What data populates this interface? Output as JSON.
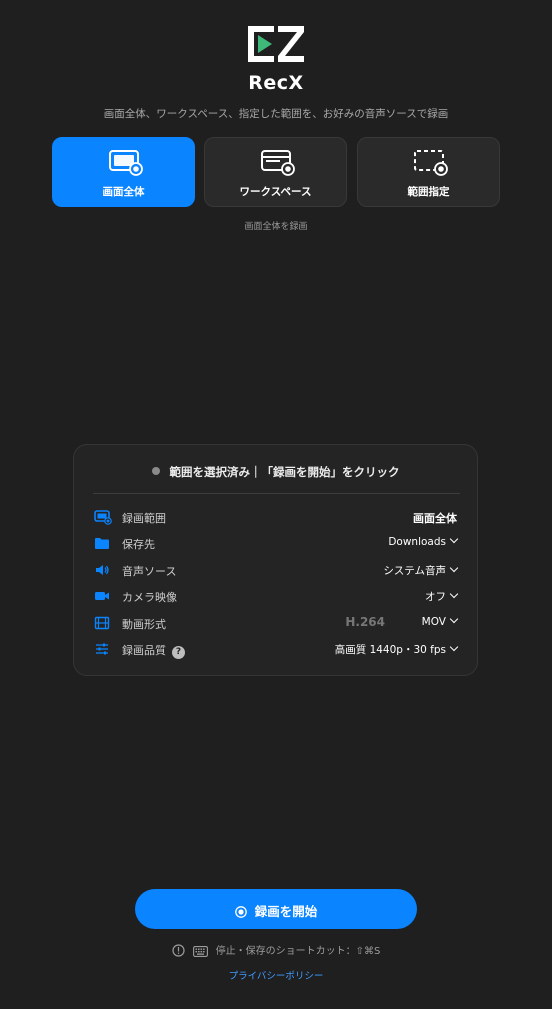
{
  "app": {
    "title": "RecX",
    "subtitle": "画面全体、ワークスペース、指定した範囲を、お好みの音声ソースで録画"
  },
  "modes": [
    {
      "label": "画面全体",
      "icon": "full-screen-icon",
      "active": true
    },
    {
      "label": "ワークスペース",
      "icon": "workspace-icon",
      "active": false
    },
    {
      "label": "範囲指定",
      "icon": "region-select-icon",
      "active": false
    }
  ],
  "mode_caption": "画面全体を録画",
  "panel": {
    "status": "範囲を選択済み｜「録画を開始」をクリック",
    "rows": {
      "range": {
        "label": "録画範囲",
        "value": "画面全体",
        "icon": "screen-icon"
      },
      "save": {
        "label": "保存先",
        "value": "Downloads",
        "icon": "folder-icon"
      },
      "audio": {
        "label": "音声ソース",
        "value": "システム音声",
        "icon": "speaker-icon"
      },
      "camera": {
        "label": "カメラ映像",
        "value": "オフ",
        "icon": "video-camera-icon"
      },
      "format": {
        "label": "動画形式",
        "codec": "H.264",
        "value": "MOV",
        "icon": "film-icon"
      },
      "quality": {
        "label": "録画品質",
        "help": "?",
        "value": "高画質 1440p・30 fps",
        "icon": "sliders-icon"
      }
    }
  },
  "start_button": {
    "label": "録画を開始"
  },
  "shortcut": {
    "text": "停止・保存のショートカット：⇧⌘S"
  },
  "privacy": {
    "label": "プライバシーポリシー"
  },
  "colors": {
    "accent": "#0a84ff",
    "background": "#1f1f1f",
    "panel": "#242424",
    "logo_green": "#3fb979"
  }
}
